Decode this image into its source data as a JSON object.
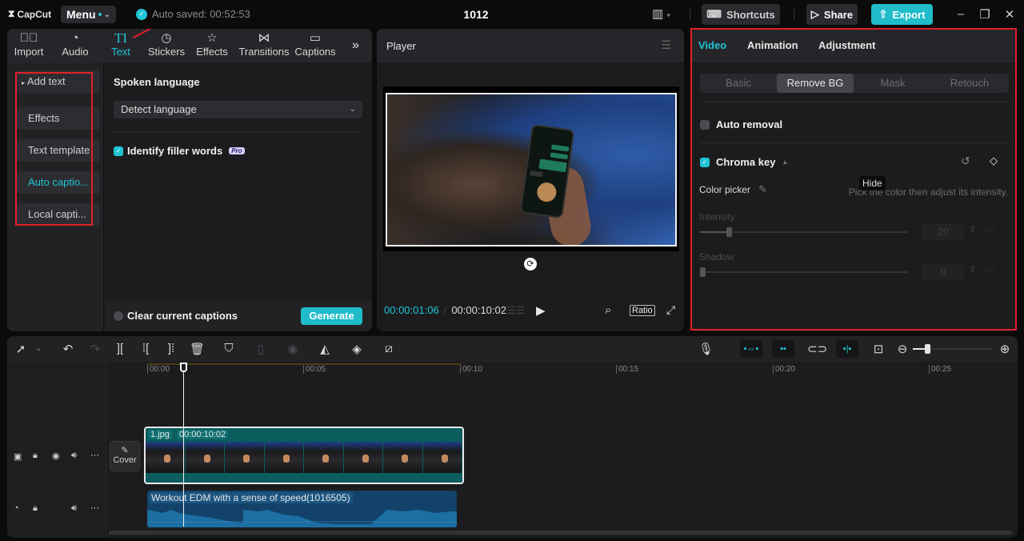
{
  "app": {
    "name": "CapCut",
    "project_title": "1012"
  },
  "topbar": {
    "menu_label": "Menu",
    "autosave": "Auto saved: 00:52:53",
    "shortcuts_label": "Shortcuts",
    "share_label": "Share",
    "export_label": "Export",
    "accent_color": "#20c5d5"
  },
  "media_tabs": [
    {
      "label": "Import",
      "icon": "import-icon"
    },
    {
      "label": "Audio",
      "icon": "audio-icon"
    },
    {
      "label": "Text",
      "icon": "text-icon",
      "active": true
    },
    {
      "label": "Stickers",
      "icon": "sticker-icon"
    },
    {
      "label": "Effects",
      "icon": "effects-icon"
    },
    {
      "label": "Transitions",
      "icon": "transitions-icon"
    },
    {
      "label": "Captions",
      "icon": "captions-icon"
    }
  ],
  "text_sidebar": {
    "items": [
      {
        "label": "Add text"
      },
      {
        "label": "Effects"
      },
      {
        "label": "Text template"
      },
      {
        "label": "Auto captio...",
        "active": true
      },
      {
        "label": "Local capti..."
      }
    ]
  },
  "captions": {
    "spoken_language_label": "Spoken language",
    "language_value": "Detect language",
    "identify_filler_label": "Identify filler words",
    "identify_filler_checked": true,
    "pro_badge": "Pro",
    "clear_label": "Clear current captions",
    "clear_checked": false,
    "generate_label": "Generate"
  },
  "player": {
    "title": "Player",
    "current_time": "00:00:01:06",
    "total_time": "00:00:10:02",
    "ratio_label": "Ratio"
  },
  "inspector": {
    "tabs": [
      {
        "label": "Video",
        "active": true
      },
      {
        "label": "Animation"
      },
      {
        "label": "Adjustment"
      }
    ],
    "subtabs": [
      {
        "label": "Basic"
      },
      {
        "label": "Remove BG",
        "active": true
      },
      {
        "label": "Mask"
      },
      {
        "label": "Retouch"
      }
    ],
    "auto_removal_label": "Auto removal",
    "auto_removal_checked": false,
    "chroma_key_label": "Chroma key",
    "chroma_key_checked": true,
    "tooltip": "Hide",
    "color_picker_label": "Color picker",
    "color_picker_hint": "Pick the color then adjust its intensity.",
    "intensity_label": "Intensity",
    "intensity_value": "20",
    "intensity_fraction": 0.2,
    "shadow_label": "Shadow",
    "shadow_value": "0",
    "shadow_fraction": 0
  },
  "timeline": {
    "ruler": [
      "00:00",
      "00:05",
      "00:10",
      "00:15",
      "00:20",
      "00:25"
    ],
    "cover_label": "Cover",
    "video_clip": {
      "name": "1.jpg",
      "duration": "00:00:10:02"
    },
    "audio_clip": {
      "name": "Workout EDM with a sense of speed(1016505)"
    },
    "zoom_fraction": 0.15
  }
}
